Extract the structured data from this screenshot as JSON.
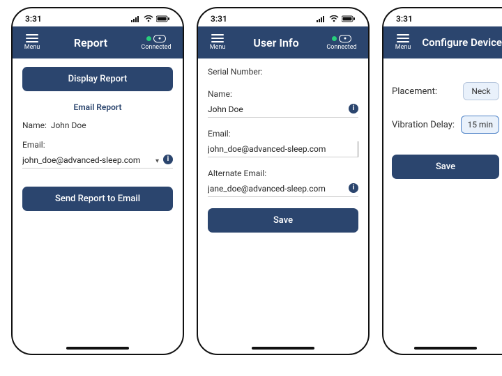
{
  "status": {
    "time": "3:31"
  },
  "header": {
    "menu": "Menu",
    "connected": "Connected"
  },
  "screens": {
    "report": {
      "title": "Report",
      "display_btn": "Display Report",
      "section": "Email Report",
      "name_label": "Name:",
      "name_value": "John Doe",
      "email_label": "Email:",
      "email_value": "john_doe@advanced-sleep.com",
      "send_btn": "Send Report to Email"
    },
    "userinfo": {
      "title": "User Info",
      "serial_label": "Serial Number:",
      "name_label": "Name:",
      "name_value": "John Doe",
      "email_label": "Email:",
      "email_value": "john_doe@advanced-sleep.com",
      "alt_label": "Alternate Email:",
      "alt_value": "jane_doe@advanced-sleep.com",
      "save_btn": "Save"
    },
    "config": {
      "title": "Configure Device",
      "placement_label": "Placement:",
      "placement_value": "Neck",
      "delay_label": "Vibration Delay:",
      "delay_value": "15 min",
      "save_btn": "Save"
    }
  }
}
